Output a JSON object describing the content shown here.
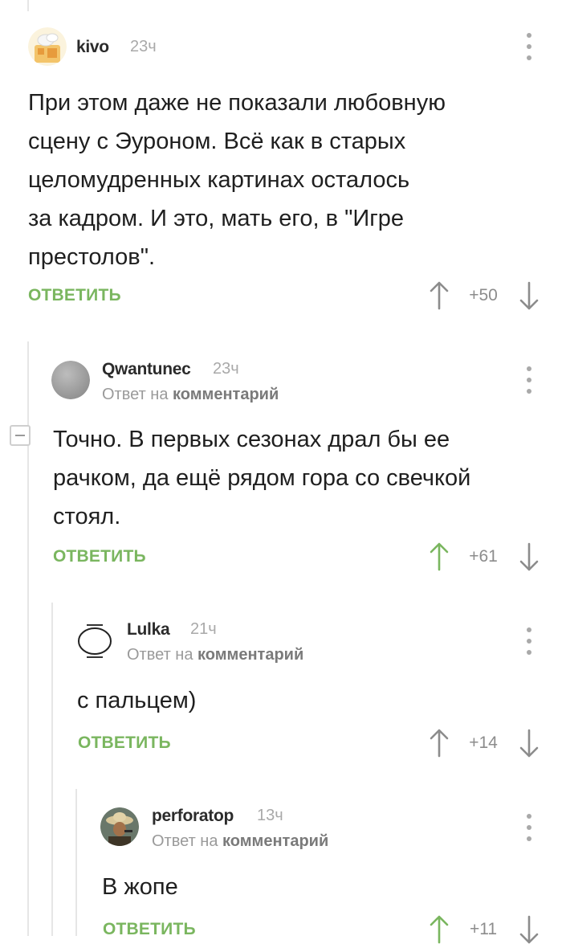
{
  "comments": [
    {
      "username": "kivo",
      "time": "23ч",
      "reply_to_prefix": "",
      "reply_to_link": "",
      "text_lines": [
        "При этом даже не показали любовную",
        "сцену с Эуроном. Всё как в старых",
        "целомудренных картинах осталось",
        "за кадром. И это, мать его, в \"Игре",
        "престолов\"."
      ],
      "reply_label": "ОТВЕТИТЬ",
      "score": "+50",
      "upvoted": false
    },
    {
      "username": "Qwantunec",
      "time": "23ч",
      "reply_to_prefix": "Ответ на",
      "reply_to_link": "комментарий",
      "text_lines": [
        "Точно. В первых сезонах драл бы ее",
        "рачком, да ещё рядом гора со свечкой",
        "стоял."
      ],
      "reply_label": "ОТВЕТИТЬ",
      "score": "+61",
      "upvoted": true
    },
    {
      "username": "Lulka",
      "time": "21ч",
      "reply_to_prefix": "Ответ на",
      "reply_to_link": "комментарий",
      "text_lines": [
        "с пальцем)"
      ],
      "reply_label": "ОТВЕТИТЬ",
      "score": "+14",
      "upvoted": false
    },
    {
      "username": "perforatop",
      "time": "13ч",
      "reply_to_prefix": "Ответ на",
      "reply_to_link": "комментарий",
      "text_lines": [
        "В жопе"
      ],
      "reply_label": "ОТВЕТИТЬ",
      "score": "+11",
      "upvoted": true
    }
  ],
  "icons": {
    "menu": "more-vertical-icon",
    "up": "arrow-up-icon",
    "down": "arrow-down-icon",
    "collapse": "minus-icon"
  },
  "colors": {
    "accent_green": "#7ab65f",
    "arrow_gray": "#8c8c8c",
    "thread_line": "#e6e6e6"
  }
}
